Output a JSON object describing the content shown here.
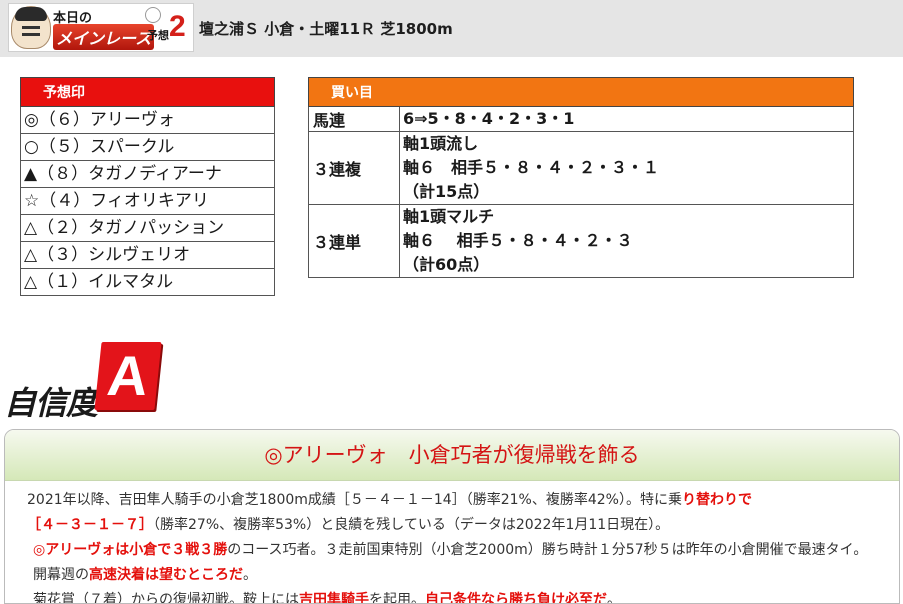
{
  "header": {
    "logo": {
      "top": "本日の",
      "main": "メインレース",
      "sub": "予想",
      "num": "2"
    },
    "race_title": "壇之浦Ｓ 小倉・土曜11Ｒ 芝1800m"
  },
  "yoso": {
    "title": "予想印",
    "rows": [
      "◎（６）アリーヴォ",
      "○（５）スパークル",
      "▲（８）タガノディアーナ",
      "☆（４）フィオリキアリ",
      "△（２）タガノパッション",
      "△（３）シルヴェリオ",
      "△（１）イルマタル"
    ]
  },
  "kaime": {
    "title": "買い目",
    "rows": [
      {
        "type": "馬連",
        "lines": [
          "6⇒5・8・4・2・3・1"
        ]
      },
      {
        "type": "３連複",
        "lines": [
          "軸1頭流し",
          "軸６　相手５・８・４・２・３・１",
          "（計15点）"
        ]
      },
      {
        "type": "３連単",
        "lines": [
          "軸1頭マルチ",
          "軸６　 相手５・８・４・２・３",
          "（計60点）"
        ]
      }
    ]
  },
  "confidence": {
    "label": "自信度",
    "grade": "A"
  },
  "comment": {
    "title": "◎アリーヴォ　小倉巧者が復帰戦を飾る",
    "p1": {
      "a": "2021年以降、吉田隼人騎手の小倉芝1800m成績［５－４－１－14］（勝率21%、複勝率42%）。特に乗",
      "b": "り替わりで",
      "c": "［４－３－１－７］",
      "d": "（勝率27%、複勝率53%）と良績を残している（データは2022年1月11日現在）。"
    },
    "p2": {
      "a": "◎アリーヴォは小倉で３戦３勝",
      "b": "のコース巧者。３走前国東特別（小倉芝2000m）勝ち時計１分57秒５は昨年の小倉開催で最速タイ。開幕週の",
      "c": "高速決着は望むところだ",
      "d": "。"
    },
    "p3": {
      "a": "菊花賞（７着）からの復帰初戦。鞍上には",
      "b": "吉田隼騎手",
      "c": "を起用。",
      "d": "自己条件なら勝ち負け必至だ",
      "e": "。"
    }
  }
}
